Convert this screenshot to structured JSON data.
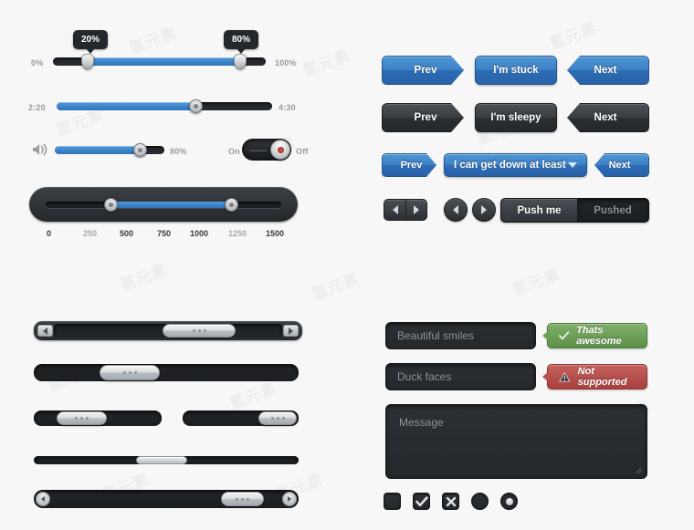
{
  "sliders": {
    "percent": {
      "min_label": "0%",
      "max_label": "100%",
      "start_tooltip": "20%",
      "end_tooltip": "80%",
      "start_value": 20,
      "end_value": 80
    },
    "time": {
      "min_label": "2:20",
      "max_label": "4:30",
      "value": 62
    },
    "volume": {
      "icon": "speaker-icon",
      "value_label": "80%",
      "value": 80
    },
    "toggle": {
      "on_label": "On",
      "off_label": "Off",
      "state": "off"
    },
    "range": {
      "ticks": [
        "0",
        "250",
        "500",
        "750",
        "1000",
        "1250",
        "1500"
      ],
      "active_ticks": [
        "250",
        "1250"
      ],
      "start_value": 250,
      "end_value": 1250,
      "min": 0,
      "max": 1500
    }
  },
  "buttons": {
    "row_blue": [
      {
        "label": "Prev",
        "shape": "arrow-left"
      },
      {
        "label": "I'm stuck",
        "shape": "rounded"
      },
      {
        "label": "Next",
        "shape": "arrow-right"
      }
    ],
    "row_dark": [
      {
        "label": "Prev",
        "shape": "arrow-left"
      },
      {
        "label": "I'm sleepy",
        "shape": "rounded"
      },
      {
        "label": "Next",
        "shape": "arrow-right"
      }
    ],
    "row_dropdown": {
      "prev_label": "Prev",
      "select_value": "I can get down at least",
      "next_label": "Next",
      "caret_icon": "chevron-down-icon"
    },
    "steppers": {
      "rect_prev_icon": "triangle-left-icon",
      "rect_next_icon": "triangle-right-icon",
      "circle_prev_icon": "triangle-left-icon",
      "circle_next_icon": "triangle-right-icon"
    },
    "segmented": {
      "active_label": "Push me",
      "inactive_label": "Pushed"
    }
  },
  "scrollbars": [
    {
      "name": "scrollbar-with-end-buttons",
      "thumb_grip": "grip-dots-icon"
    },
    {
      "name": "scrollbar-plain-left",
      "thumb_grip": "grip-dots-icon"
    },
    {
      "name": "scrollbar-short-left",
      "thumb_grip": "grip-dots-icon"
    },
    {
      "name": "scrollbar-short-right",
      "thumb_grip": "grip-dots-icon"
    },
    {
      "name": "scrollbar-thin",
      "thumb_grip": "none"
    },
    {
      "name": "scrollbar-round-end-buttons",
      "thumb_grip": "grip-dots-icon"
    }
  ],
  "form": {
    "fields": [
      {
        "value": "Beautiful smiles",
        "badge": {
          "text": "Thats awesome",
          "status": "ok",
          "icon": "check-icon"
        }
      },
      {
        "value": "Duck faces",
        "badge": {
          "text": "Not supported",
          "status": "error",
          "icon": "warning-icon"
        }
      }
    ],
    "textarea": {
      "placeholder": "Message",
      "value": ""
    },
    "controls": [
      {
        "type": "checkbox",
        "name": "checkbox-empty",
        "state": "unchecked",
        "icon": "none"
      },
      {
        "type": "checkbox",
        "name": "checkbox-checked",
        "state": "checked",
        "icon": "check-icon"
      },
      {
        "type": "checkbox",
        "name": "checkbox-crossed",
        "state": "crossed",
        "icon": "cross-icon"
      },
      {
        "type": "radio",
        "name": "radio-empty",
        "state": "unselected",
        "icon": "none"
      },
      {
        "type": "radio",
        "name": "radio-selected",
        "state": "selected",
        "icon": "dot-icon"
      }
    ]
  },
  "colors": {
    "accent_blue": "#3c81c6",
    "dark": "#24272b",
    "success": "#5d9049",
    "danger": "#a8413e",
    "background": "#f7f7f7"
  },
  "watermark": "氢元素"
}
